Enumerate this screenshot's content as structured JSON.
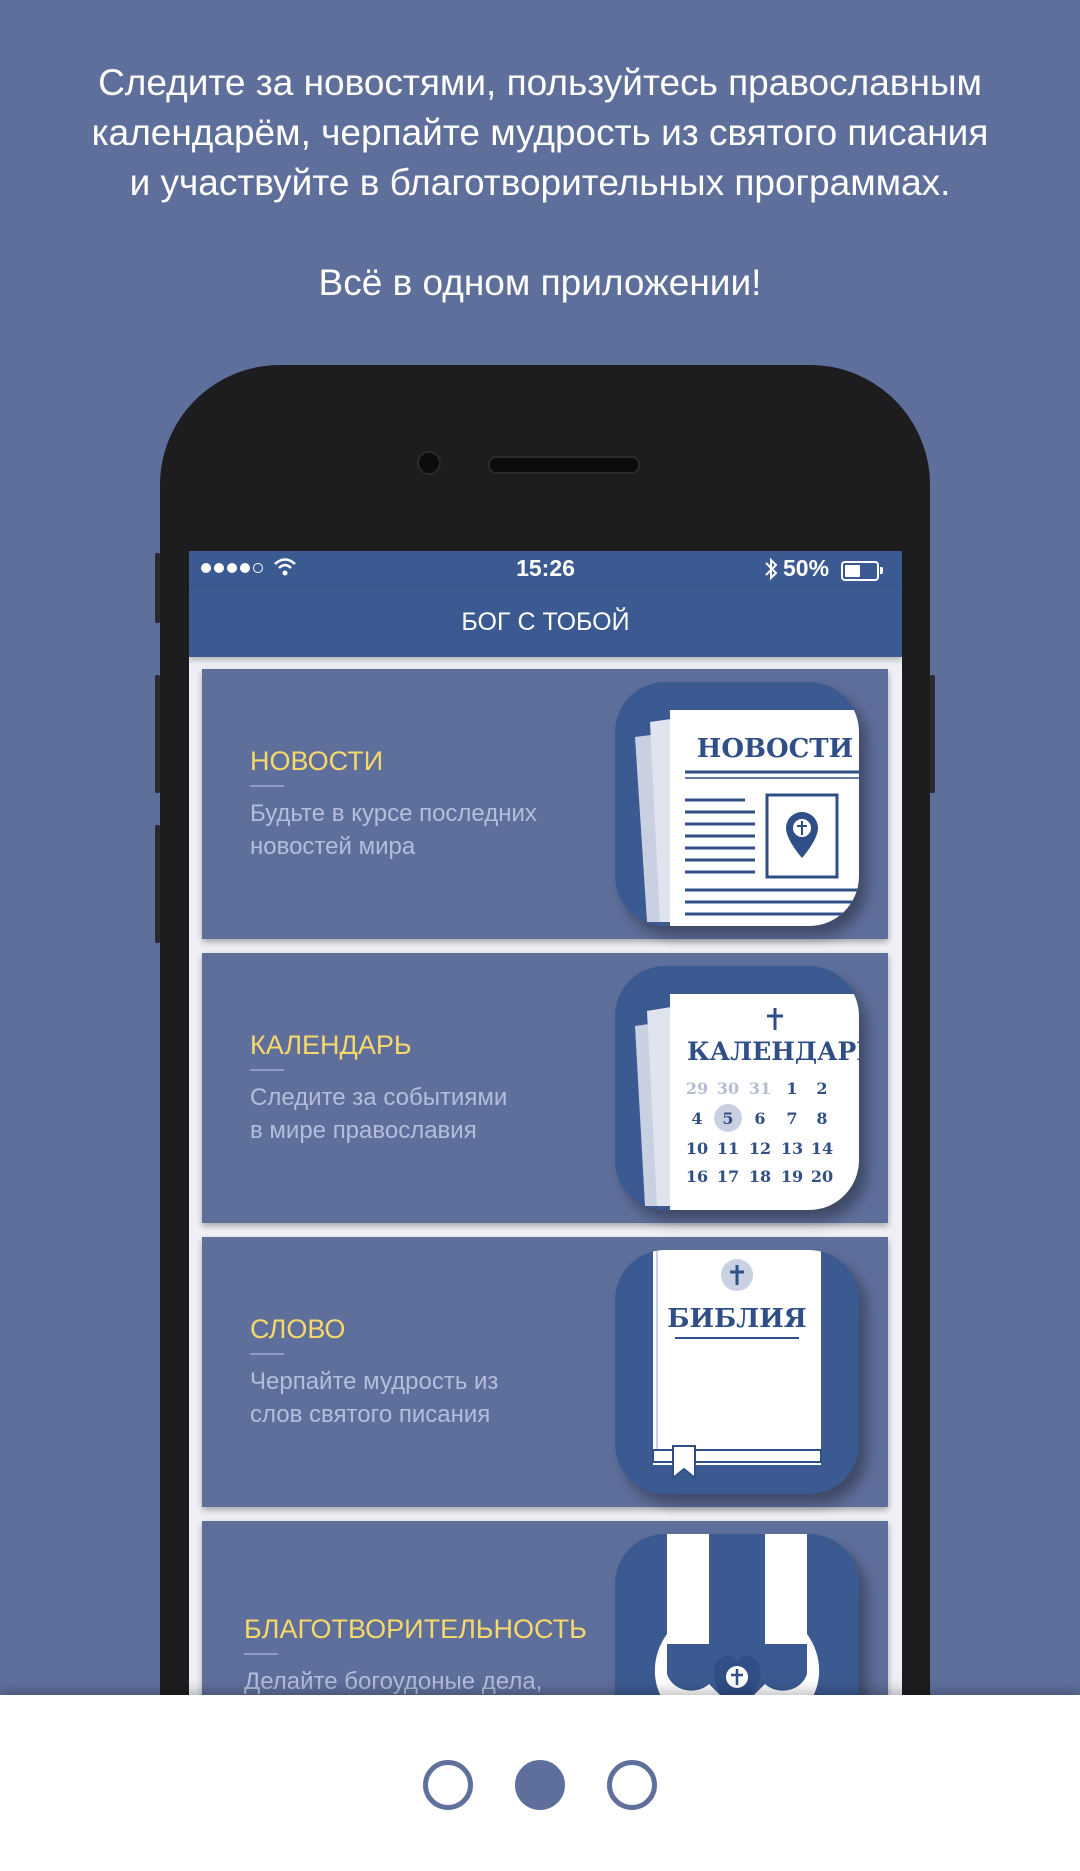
{
  "promo": {
    "line1": "Следите за новостями, пользуйтесь православным",
    "line2": "календарём, черпайте мудрость из святого писания",
    "line3": "и участвуйте в благотворительных программах.",
    "line4": "Всё в одном приложении!"
  },
  "status_bar": {
    "time": "15:26",
    "battery": "50%"
  },
  "nav": {
    "title": "БОГ С ТОБОЙ"
  },
  "cards": [
    {
      "title": "НОВОСТИ",
      "desc_line1": "Будьте в курсе последних",
      "desc_line2": "новостей мира",
      "icon": "newspaper-icon",
      "icon_label": "НОВОСТИ"
    },
    {
      "title": "КАЛЕНДАРЬ",
      "desc_line1": "Следите за событиями",
      "desc_line2": "в мире православия",
      "icon": "calendar-icon",
      "icon_label": "КАЛЕНДАРЬ",
      "calendar_rows": [
        [
          "29",
          "30",
          "31",
          "1",
          "2"
        ],
        [
          "4",
          "5",
          "6",
          "7",
          "8"
        ],
        [
          "10",
          "11",
          "12",
          "13",
          "14"
        ],
        [
          "16",
          "17",
          "18",
          "19",
          "20"
        ]
      ],
      "highlighted_day": "5"
    },
    {
      "title": "СЛОВО",
      "desc_line1": "Черпайте мудрость из",
      "desc_line2": "слов святого писания",
      "icon": "bible-icon",
      "icon_label": "БИБЛИЯ"
    },
    {
      "title": "БЛАГОТВОРИТЕЛЬНОСТЬ",
      "desc_line1": "Делайте богоудоные дела,",
      "desc_line2": "",
      "icon": "charity-hands-icon",
      "icon_label": ""
    }
  ],
  "pager": {
    "count": 3,
    "active_index": 1
  },
  "colors": {
    "background": "#5f6f9c",
    "brand": "#3b5a91",
    "title_accent": "#f7d96a",
    "desc": "#b4bddb"
  }
}
